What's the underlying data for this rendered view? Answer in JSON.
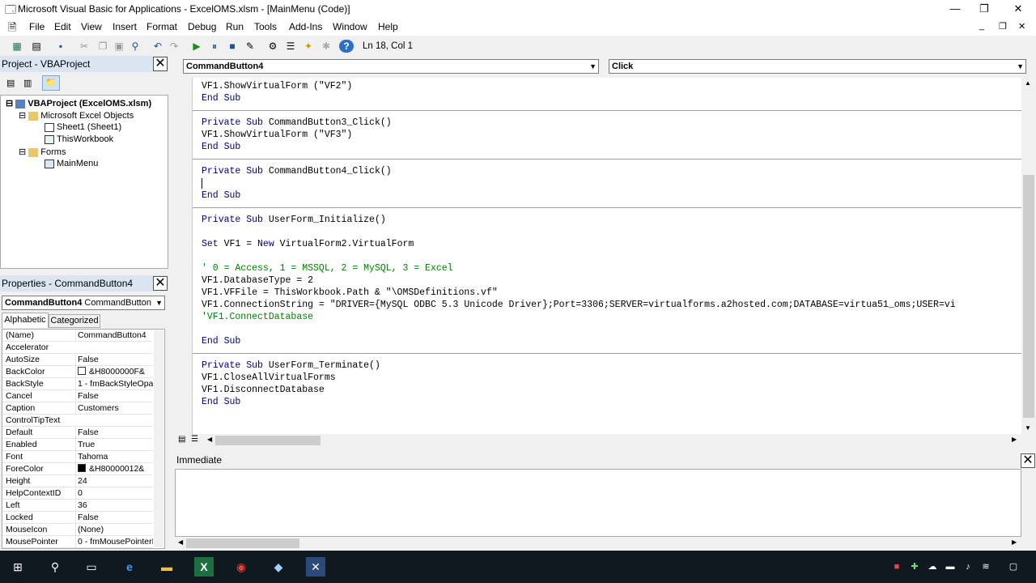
{
  "window": {
    "title": "Microsoft Visual Basic for Applications - ExcelOMS.xlsm - [MainMenu (Code)]",
    "minimize": "—",
    "restore": "❐",
    "close": "✕",
    "inner_minimize": "_",
    "inner_restore": "❐",
    "inner_close": "✕"
  },
  "menu": [
    "File",
    "Edit",
    "View",
    "Insert",
    "Format",
    "Debug",
    "Run",
    "Tools",
    "Add-Ins",
    "Window",
    "Help"
  ],
  "toolbar": {
    "position": "Ln 18, Col 1"
  },
  "project": {
    "title": "Project - VBAProject",
    "tree": [
      {
        "label": "VBAProject (ExcelOMS.xlsm)"
      },
      {
        "label": "Microsoft Excel Objects"
      },
      {
        "label": "Sheet1 (Sheet1)"
      },
      {
        "label": "ThisWorkbook"
      },
      {
        "label": "Forms"
      },
      {
        "label": "MainMenu"
      }
    ]
  },
  "properties": {
    "title": "Properties - CommandButton4",
    "object_name": "CommandButton4",
    "object_type": "CommandButton",
    "tabs": [
      "Alphabetic",
      "Categorized"
    ],
    "rows": [
      {
        "name": "(Name)",
        "value": "CommandButton4"
      },
      {
        "name": "Accelerator",
        "value": ""
      },
      {
        "name": "AutoSize",
        "value": "False"
      },
      {
        "name": "BackColor",
        "value": "&H8000000F&"
      },
      {
        "name": "BackStyle",
        "value": "1 - fmBackStyleOpaq"
      },
      {
        "name": "Cancel",
        "value": "False"
      },
      {
        "name": "Caption",
        "value": "Customers"
      },
      {
        "name": "ControlTipText",
        "value": ""
      },
      {
        "name": "Default",
        "value": "False"
      },
      {
        "name": "Enabled",
        "value": "True"
      },
      {
        "name": "Font",
        "value": "Tahoma"
      },
      {
        "name": "ForeColor",
        "value": "&H80000012&"
      },
      {
        "name": "Height",
        "value": "24"
      },
      {
        "name": "HelpContextID",
        "value": "0"
      },
      {
        "name": "Left",
        "value": "36"
      },
      {
        "name": "Locked",
        "value": "False"
      },
      {
        "name": "MouseIcon",
        "value": "(None)"
      },
      {
        "name": "MousePointer",
        "value": "0 - fmMousePointerD"
      }
    ]
  },
  "code": {
    "object_combo": "CommandButton4",
    "proc_combo": "Click",
    "lines": [
      {
        "segs": [
          {
            "t": "VF1.ShowVirtualForm (\"VF2\")",
            "c": ""
          }
        ]
      },
      {
        "segs": [
          {
            "t": "End Sub",
            "c": "kw"
          }
        ]
      },
      {
        "segs": []
      },
      {
        "segs": [
          {
            "t": "Private Sub",
            "c": "kw"
          },
          {
            "t": " CommandButton3_Click()",
            "c": ""
          }
        ]
      },
      {
        "segs": [
          {
            "t": "VF1.ShowVirtualForm (\"VF3\")",
            "c": ""
          }
        ]
      },
      {
        "segs": [
          {
            "t": "End Sub",
            "c": "kw"
          }
        ]
      },
      {
        "segs": []
      },
      {
        "segs": [
          {
            "t": "Private Sub",
            "c": "kw"
          },
          {
            "t": " CommandButton4_Click()",
            "c": ""
          }
        ]
      },
      {
        "segs": []
      },
      {
        "segs": [
          {
            "t": "End Sub",
            "c": "kw"
          }
        ]
      },
      {
        "segs": []
      },
      {
        "segs": [
          {
            "t": "Private Sub",
            "c": "kw"
          },
          {
            "t": " UserForm_Initialize()",
            "c": ""
          }
        ]
      },
      {
        "segs": []
      },
      {
        "segs": [
          {
            "t": "Set",
            "c": "kw"
          },
          {
            "t": " VF1 = ",
            "c": ""
          },
          {
            "t": "New",
            "c": "kw"
          },
          {
            "t": " VirtualForm2.VirtualForm",
            "c": ""
          }
        ]
      },
      {
        "segs": []
      },
      {
        "segs": [
          {
            "t": "' 0 = Access, 1 = MSSQL, 2 = MySQL, 3 = Excel",
            "c": "cm"
          }
        ]
      },
      {
        "segs": [
          {
            "t": "VF1.DatabaseType = 2",
            "c": ""
          }
        ]
      },
      {
        "segs": [
          {
            "t": "VF1.VFFile = ThisWorkbook.Path & \"\\OMSDefinitions.vf\"",
            "c": ""
          }
        ]
      },
      {
        "segs": [
          {
            "t": "VF1.ConnectionString = \"DRIVER={MySQL ODBC 5.3 Unicode Driver};Port=3306;SERVER=virtualforms.a2hosted.com;DATABASE=virtua51_oms;USER=vi",
            "c": ""
          }
        ]
      },
      {
        "segs": [
          {
            "t": "'VF1.ConnectDatabase",
            "c": "cm"
          }
        ]
      },
      {
        "segs": []
      },
      {
        "segs": [
          {
            "t": "End Sub",
            "c": "kw"
          }
        ]
      },
      {
        "segs": []
      },
      {
        "segs": [
          {
            "t": "Private Sub",
            "c": "kw"
          },
          {
            "t": " UserForm_Terminate()",
            "c": ""
          }
        ]
      },
      {
        "segs": [
          {
            "t": "VF1.CloseAllVirtualForms",
            "c": ""
          }
        ]
      },
      {
        "segs": [
          {
            "t": "VF1.DisconnectDatabase",
            "c": ""
          }
        ]
      },
      {
        "segs": [
          {
            "t": "End Sub",
            "c": "kw"
          }
        ]
      }
    ]
  },
  "immediate": {
    "title": "Immediate"
  },
  "colors": {
    "keyword": "#00007f",
    "comment": "#008000",
    "panel_title": "#dbe5f1",
    "taskbar": "#101820"
  },
  "taskbar_icons": [
    "windows-start-icon",
    "search-icon",
    "task-view-icon",
    "edge-icon",
    "file-explorer-icon",
    "excel-icon",
    "chrome-icon",
    "notepad-icon",
    "vba-editor-icon"
  ]
}
